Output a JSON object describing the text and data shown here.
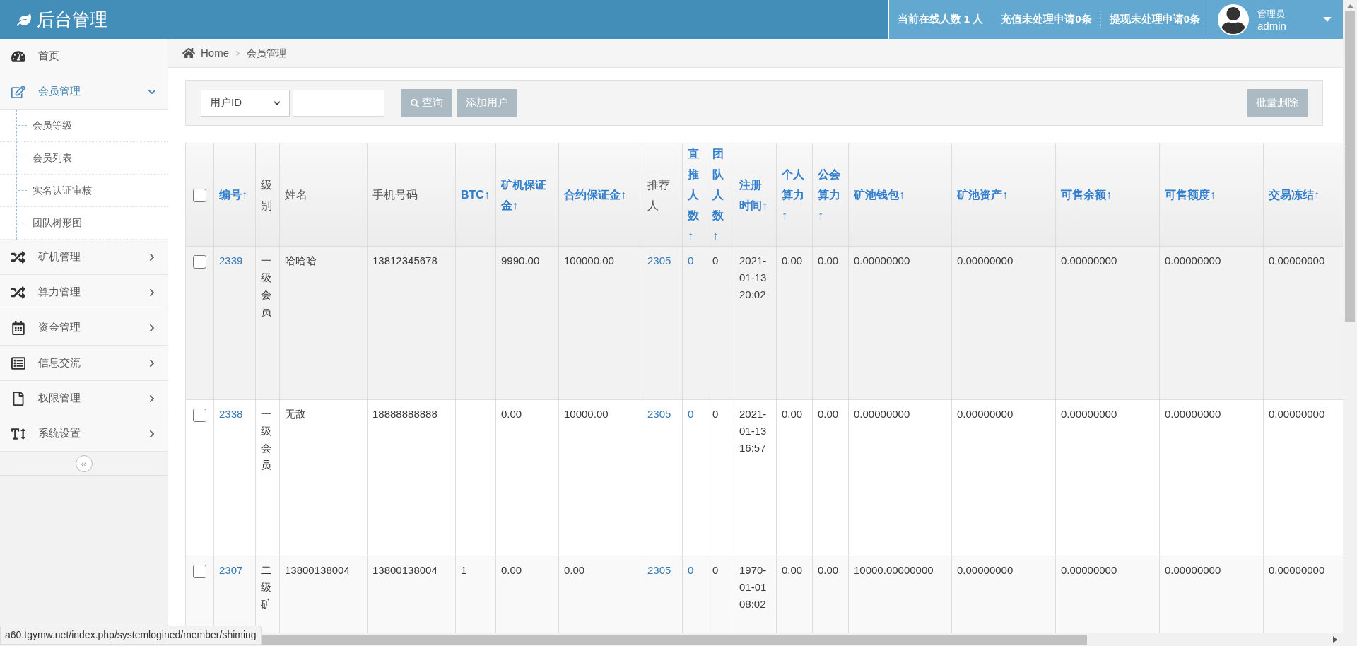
{
  "header": {
    "title": "后台管理",
    "stats": [
      "当前在线人数 1 人",
      "充值未处理申请0条",
      "提现未处理申请0条"
    ],
    "user": {
      "role": "管理员",
      "name": "admin"
    }
  },
  "sidebar": {
    "items": [
      {
        "label": "首页",
        "kind": "link",
        "selected": false
      },
      {
        "label": "会员管理",
        "kind": "menu",
        "selected": true,
        "expanded": true,
        "children": [
          {
            "label": "会员等级"
          },
          {
            "label": "会员列表"
          },
          {
            "label": "实名认证审核"
          },
          {
            "label": "团队树形图"
          }
        ]
      },
      {
        "label": "矿机管理",
        "kind": "menu",
        "selected": false,
        "expanded": false
      },
      {
        "label": "算力管理",
        "kind": "menu",
        "selected": false,
        "expanded": false
      },
      {
        "label": "资金管理",
        "kind": "menu",
        "selected": false,
        "expanded": false
      },
      {
        "label": "信息交流",
        "kind": "menu",
        "selected": false,
        "expanded": false
      },
      {
        "label": "权限管理",
        "kind": "menu",
        "selected": false,
        "expanded": false
      },
      {
        "label": "系统设置",
        "kind": "menu",
        "selected": false,
        "expanded": false
      }
    ],
    "collapse": "«"
  },
  "breadcrumb": [
    "Home",
    "会员管理"
  ],
  "search": {
    "select": "用户ID",
    "buttons": [
      "查询",
      "添加用户"
    ],
    "batch_delete": "批量删除"
  },
  "table": {
    "select_all_checked": false,
    "columns": [
      {
        "label": "编号↑",
        "sortable": true,
        "link": true
      },
      {
        "label": "级别",
        "sortable": false,
        "link": false
      },
      {
        "label": "姓名",
        "sortable": false,
        "link": false
      },
      {
        "label": "手机号码",
        "sortable": false,
        "link": false
      },
      {
        "label": "BTC↑",
        "sortable": true,
        "link": false
      },
      {
        "label": "矿机保证金↑",
        "sortable": true,
        "link": false
      },
      {
        "label": "合约保证金↑",
        "sortable": true,
        "link": false
      },
      {
        "label": "推荐人",
        "sortable": false,
        "link": true
      },
      {
        "label": "直推人数↑",
        "sortable": true,
        "link": true
      },
      {
        "label": "团队人数↑",
        "sortable": true,
        "link": false
      },
      {
        "label": "注册时间↑",
        "sortable": true,
        "link": false
      },
      {
        "label": "个人算力↑",
        "sortable": true,
        "link": false
      },
      {
        "label": "公会算力↑",
        "sortable": true,
        "link": false
      },
      {
        "label": "矿池钱包↑",
        "sortable": true,
        "link": false
      },
      {
        "label": "矿池资产↑",
        "sortable": true,
        "link": false
      },
      {
        "label": "可售余额↑",
        "sortable": true,
        "link": false
      },
      {
        "label": "可售额度↑",
        "sortable": true,
        "link": false
      },
      {
        "label": "交易冻结↑",
        "sortable": true,
        "link": false
      }
    ],
    "rows": [
      {
        "checked": false,
        "cells": [
          "2339",
          "一级会员",
          "哈哈哈",
          "13812345678",
          "",
          "9990.00",
          "100000.00",
          "2305",
          "0",
          "0",
          "2021-01-13 20:02",
          "0.00",
          "0.00",
          "0.00000000",
          "0.00000000",
          "0.00000000",
          "0.00000000",
          "0.00000000"
        ]
      },
      {
        "checked": false,
        "cells": [
          "2338",
          "一级会员",
          "无敌",
          "18888888888",
          "",
          "0.00",
          "10000.00",
          "2305",
          "0",
          "0",
          "2021-01-13 16:57",
          "0.00",
          "0.00",
          "0.00000000",
          "0.00000000",
          "0.00000000",
          "0.00000000",
          "0.00000000"
        ]
      },
      {
        "checked": false,
        "cells": [
          "2307",
          "二级矿",
          "13800138004",
          "13800138004",
          "1",
          "0.00",
          "0.00",
          "2305",
          "0",
          "0",
          "1970-01-01 08:02",
          "0.00",
          "0.00",
          "10000.00000000",
          "0.00000000",
          "0.00000000",
          "0.00000000",
          "0.00000000"
        ]
      }
    ]
  },
  "status_bar": {
    "url": "a60.tgymw.net/index.php/systemlogined/member/shiming"
  }
}
